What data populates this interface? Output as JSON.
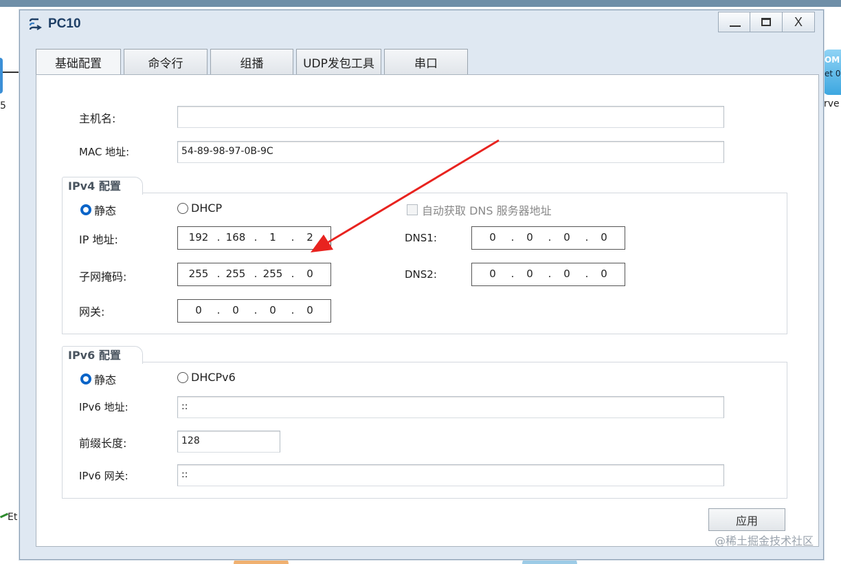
{
  "background": {
    "left_label": "5",
    "right_top_label": "OM",
    "right_mid_label": "et 0",
    "right_low_label": "rve",
    "bottom_left_label": "Et"
  },
  "window": {
    "title": "PC10",
    "controls": {
      "minimize": "–",
      "maximize": "□",
      "close": "X"
    }
  },
  "tabs": [
    {
      "label": "基础配置",
      "active": true
    },
    {
      "label": "命令行",
      "active": false
    },
    {
      "label": "组播",
      "active": false
    },
    {
      "label": "UDP发包工具",
      "active": false
    },
    {
      "label": "串口",
      "active": false
    }
  ],
  "basic": {
    "hostname_label": "主机名:",
    "hostname_value": "",
    "mac_label": "MAC 地址:",
    "mac_value": "54-89-98-97-0B-9C"
  },
  "ipv4": {
    "group_title": "IPv4 配置",
    "static_label": "静态",
    "dhcp_label": "DHCP",
    "static_selected": true,
    "auto_dns_label": "自动获取 DNS 服务器地址",
    "auto_dns_checked": false,
    "ip_label": "IP 地址:",
    "ip": [
      "192",
      "168",
      "1",
      "2"
    ],
    "mask_label": "子网掩码:",
    "mask": [
      "255",
      "255",
      "255",
      "0"
    ],
    "gateway_label": "网关:",
    "gateway": [
      "0",
      "0",
      "0",
      "0"
    ],
    "dns1_label": "DNS1:",
    "dns1": [
      "0",
      "0",
      "0",
      "0"
    ],
    "dns2_label": "DNS2:",
    "dns2": [
      "0",
      "0",
      "0",
      "0"
    ]
  },
  "ipv6": {
    "group_title": "IPv6 配置",
    "static_label": "静态",
    "dhcp_label": "DHCPv6",
    "static_selected": true,
    "address_label": "IPv6 地址:",
    "address_value": "::",
    "prefix_label": "前缀长度:",
    "prefix_value": "128",
    "gateway_label": "IPv6 网关:",
    "gateway_value": "::"
  },
  "apply_label": "应用",
  "watermark": "@稀土掘金技术社区",
  "colors": {
    "window_bg": "#dfe8f2",
    "title": "#1e3f66",
    "radio_selected": "#0a64c8",
    "annotation_arrow": "#e8231f"
  }
}
